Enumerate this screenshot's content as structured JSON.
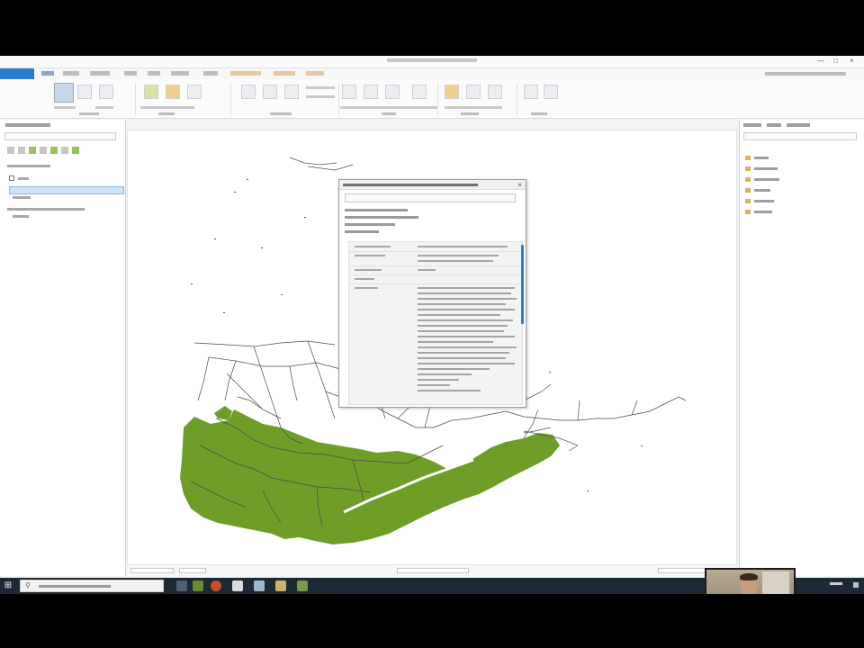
{
  "window": {
    "title": ""
  },
  "colors": {
    "accent": "#2a7dd1",
    "map_green": "#6e9e28",
    "road": "#4a4a4a",
    "taskbar": "#1d2a36"
  },
  "icons": {
    "close": "×",
    "minimize": "—",
    "maximize": "□",
    "start": "⊞",
    "search": "⚲"
  }
}
